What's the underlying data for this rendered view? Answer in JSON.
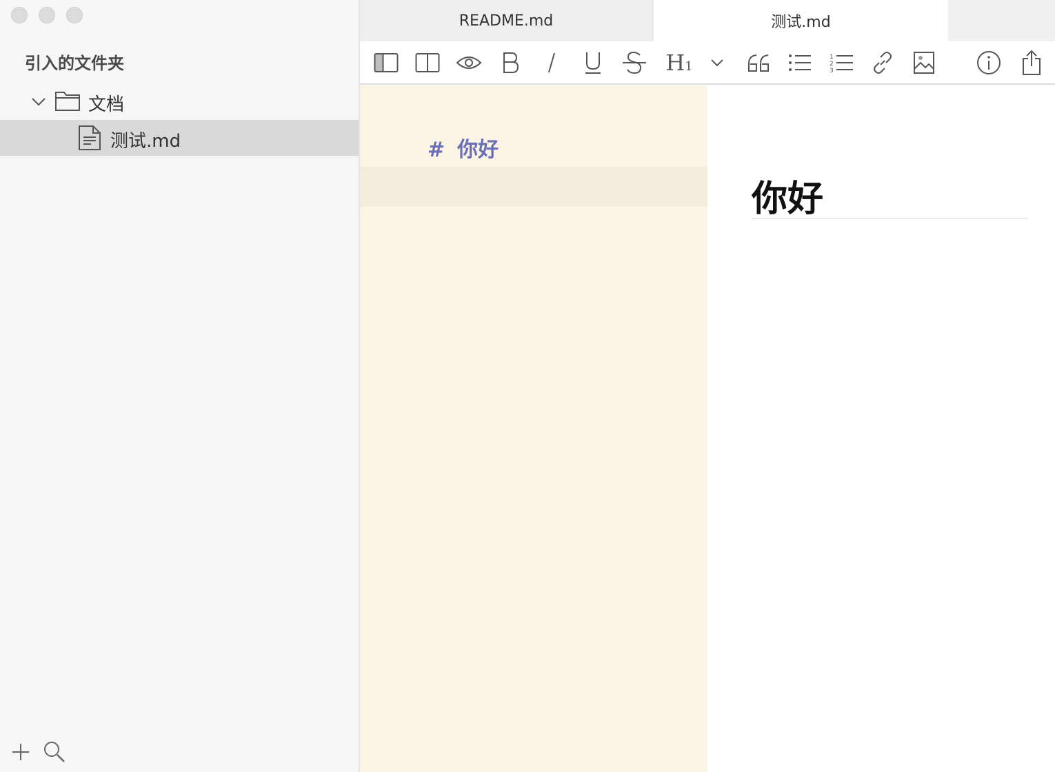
{
  "sidebar": {
    "heading": "引入的文件夹",
    "folder": {
      "label": "文档",
      "expanded": true
    },
    "file": {
      "label": "测试.md",
      "selected": true
    },
    "bottom": {
      "add_icon": "plus-icon",
      "search_icon": "search-icon"
    }
  },
  "tabs": [
    {
      "label": "README.md",
      "active": false
    },
    {
      "label": "测试.md",
      "active": true
    }
  ],
  "toolbar": {
    "icons": [
      "sidebar-toggle-icon",
      "split-view-icon",
      "preview-eye-icon",
      "bold-icon",
      "italic-icon",
      "underline-icon",
      "strikethrough-icon",
      "heading-icon",
      "heading-dropdown-icon",
      "quote-icon",
      "bullet-list-icon",
      "numbered-list-icon",
      "link-icon",
      "image-icon",
      "info-icon",
      "share-icon"
    ],
    "heading_label": "H",
    "heading_sub": "1"
  },
  "editor": {
    "hash": "#",
    "heading_text": "你好"
  },
  "preview": {
    "h1": "你好"
  },
  "colors": {
    "sidebar_bg": "#f6f6f6",
    "selection_bg": "#d9d9d9",
    "editor_bg": "#fcf5e5",
    "heading_syntax": "#6a6fb6"
  }
}
